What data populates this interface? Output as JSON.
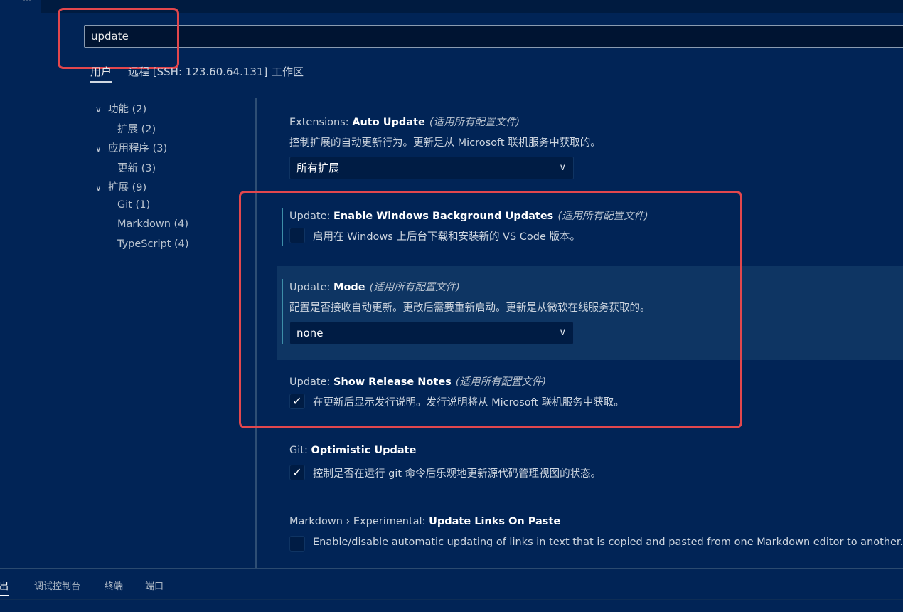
{
  "search": {
    "value": "update"
  },
  "scope_tabs": [
    {
      "label": "用户"
    },
    {
      "label": "远程 [SSH: 123.60.64.131]"
    },
    {
      "label": "工作区"
    }
  ],
  "toc": [
    {
      "label": "功能 (2)",
      "expanded": true
    },
    {
      "label": "扩展 (2)"
    },
    {
      "label": "应用程序 (3)",
      "expanded": true
    },
    {
      "label": "更新 (3)"
    },
    {
      "label": "扩展 (9)",
      "expanded": true
    },
    {
      "label": "Git (1)"
    },
    {
      "label": "Markdown (4)"
    },
    {
      "label": "TypeScript (4)"
    }
  ],
  "settings": [
    {
      "category": "Extensions: ",
      "name": "Auto Update",
      "scope": "(适用所有配置文件)",
      "description": "控制扩展的自动更新行为。更新是从 Microsoft 联机服务中获取的。",
      "control": "dropdown",
      "value": "所有扩展"
    },
    {
      "category": "Update: ",
      "name": "Enable Windows Background Updates",
      "scope": "(适用所有配置文件)",
      "description": "启用在 Windows 上后台下载和安装新的 VS Code 版本。",
      "control": "checkbox",
      "checked": false
    },
    {
      "category": "Update: ",
      "name": "Mode",
      "scope": "(适用所有配置文件)",
      "description": "配置是否接收自动更新。更改后需要重新启动。更新是从微软在线服务获取的。",
      "control": "dropdown",
      "value": "none"
    },
    {
      "category": "Update: ",
      "name": "Show Release Notes",
      "scope": "(适用所有配置文件)",
      "description": "在更新后显示发行说明。发行说明将从 Microsoft 联机服务中获取。",
      "control": "checkbox",
      "checked": true
    },
    {
      "category": "Git: ",
      "name": "Optimistic Update",
      "scope": "",
      "description": "控制是否在运行 git 命令后乐观地更新源代码管理视图的状态。",
      "control": "checkbox",
      "checked": true
    },
    {
      "category": "Markdown › Experimental: ",
      "name": "Update Links On Paste",
      "scope": "",
      "description": "Enable/disable automatic updating of links in text that is copied and pasted from one Markdown editor to another.",
      "control": "checkbox",
      "checked": false
    }
  ],
  "icons": {
    "chevron_down": "chevron-down-icon",
    "check": "check-icon"
  },
  "glyphs": {
    "chevron_down": "∨",
    "check": "✓"
  },
  "panel_tabs": [
    {
      "label": "输出",
      "visible_text": "输出"
    },
    {
      "label": "调试控制台"
    },
    {
      "label": "终端"
    },
    {
      "label": "端口"
    }
  ],
  "colors": {
    "background": "#012456",
    "highlight_border": "#e2474d",
    "focus_bar": "#3d8ea8"
  }
}
